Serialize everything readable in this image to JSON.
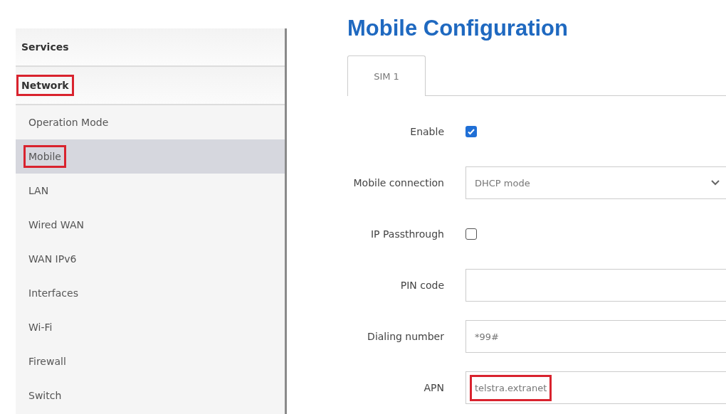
{
  "sidebar": {
    "sections": [
      {
        "label": "Services",
        "highlighted": false
      },
      {
        "label": "Network",
        "highlighted": true,
        "items": [
          {
            "label": "Operation Mode",
            "selected": false,
            "highlighted": false
          },
          {
            "label": "Mobile",
            "selected": true,
            "highlighted": true
          },
          {
            "label": "LAN",
            "selected": false,
            "highlighted": false
          },
          {
            "label": "Wired WAN",
            "selected": false,
            "highlighted": false
          },
          {
            "label": "WAN IPv6",
            "selected": false,
            "highlighted": false
          },
          {
            "label": "Interfaces",
            "selected": false,
            "highlighted": false
          },
          {
            "label": "Wi-Fi",
            "selected": false,
            "highlighted": false
          },
          {
            "label": "Firewall",
            "selected": false,
            "highlighted": false
          },
          {
            "label": "Switch",
            "selected": false,
            "highlighted": false
          }
        ]
      }
    ]
  },
  "page": {
    "title": "Mobile Configuration",
    "tabs": [
      {
        "label": "SIM 1",
        "selected": true
      }
    ],
    "fields": [
      {
        "kind": "checkbox",
        "label": "Enable",
        "checked": true
      },
      {
        "kind": "select",
        "label": "Mobile connection",
        "value": "DHCP mode"
      },
      {
        "kind": "checkbox",
        "label": "IP Passthrough",
        "checked": false
      },
      {
        "kind": "text",
        "label": "PIN code"
      },
      {
        "kind": "text",
        "label": "Dialing number",
        "value": "*99#"
      },
      {
        "kind": "text",
        "label": "APN",
        "value": "telstra.extranet",
        "highlighted": true
      }
    ]
  }
}
